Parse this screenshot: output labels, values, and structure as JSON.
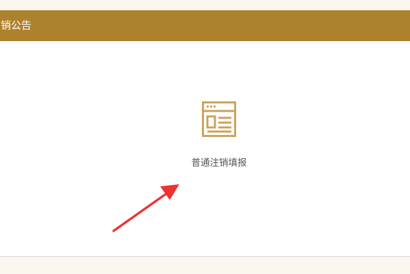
{
  "header": {
    "title": "销公告"
  },
  "main": {
    "entry": {
      "label": "普通注销填报",
      "icon": "form-document-icon"
    }
  },
  "colors": {
    "accent": "#ad822d",
    "icon": "#c9a45c",
    "annotation_arrow": "#ee3333"
  }
}
